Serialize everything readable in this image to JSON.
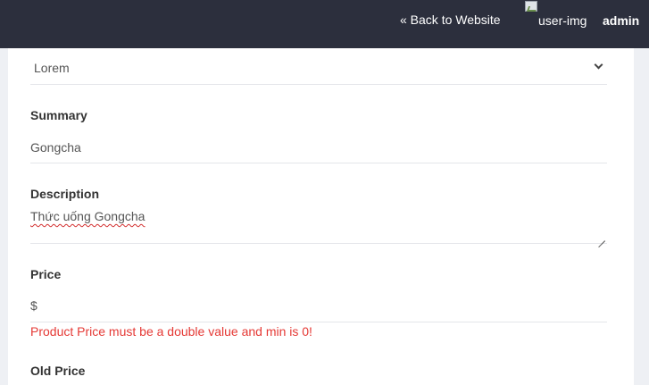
{
  "topbar": {
    "back_label": "« Back to Website",
    "user_img_alt": "user-img",
    "username": "admin"
  },
  "form": {
    "category_select": {
      "value": "Lorem"
    },
    "summary": {
      "label": "Summary",
      "value": "Gongcha"
    },
    "description": {
      "label": "Description",
      "value": "Thức uống Gongcha"
    },
    "price": {
      "label": "Price",
      "value": "$",
      "error": "Product Price must be a double value and min is 0!"
    },
    "old_price": {
      "label": "Old Price"
    }
  },
  "colors": {
    "topbar_bg": "#2c2f3d",
    "page_bg": "#eef0f4",
    "error": "#e53935"
  },
  "icons": [
    "broken-image-icon",
    "chevron-down-icon",
    "resize-handle-icon"
  ]
}
